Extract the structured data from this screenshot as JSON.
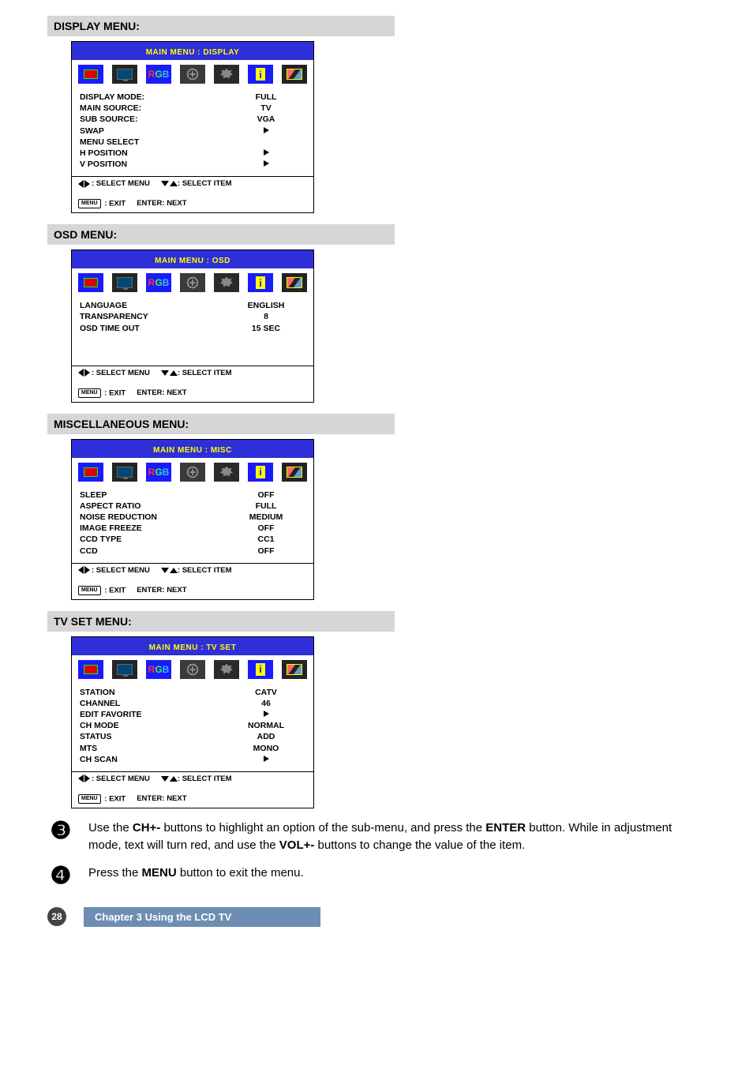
{
  "sections": {
    "display": {
      "header": "DISPLAY MENU:"
    },
    "osd": {
      "header": "OSD MENU:"
    },
    "misc": {
      "header": "MISCELLANEOUS MENU:"
    },
    "tvset": {
      "header": "TV SET MENU:"
    }
  },
  "panels": {
    "display": {
      "title": "MAIN MENU : DISPLAY",
      "rows": [
        {
          "label": "DISPLAY MODE:",
          "value": "FULL",
          "type": "text"
        },
        {
          "label": "MAIN SOURCE:",
          "value": "TV",
          "type": "text"
        },
        {
          "label": "SUB SOURCE:",
          "value": "VGA",
          "type": "text"
        },
        {
          "label": "SWAP",
          "type": "arrow"
        },
        {
          "label": "MENU SELECT",
          "type": "none"
        },
        {
          "label": "H POSITION",
          "type": "arrow"
        },
        {
          "label": "V POSITION",
          "type": "arrow"
        }
      ]
    },
    "osd": {
      "title": "MAIN MENU : OSD",
      "rows": [
        {
          "label": "LANGUAGE",
          "value": "ENGLISH",
          "type": "text"
        },
        {
          "label": "TRANSPARENCY",
          "value": "8",
          "type": "text"
        },
        {
          "label": "OSD TIME OUT",
          "value": "15 SEC",
          "type": "text"
        }
      ]
    },
    "misc": {
      "title": "MAIN MENU : MISC",
      "rows": [
        {
          "label": "SLEEP",
          "value": "OFF",
          "type": "text"
        },
        {
          "label": "ASPECT RATIO",
          "value": "FULL",
          "type": "text"
        },
        {
          "label": "NOISE REDUCTION",
          "value": "MEDIUM",
          "type": "text"
        },
        {
          "label": "IMAGE FREEZE",
          "value": "OFF",
          "type": "text"
        },
        {
          "label": "CCD TYPE",
          "value": "CC1",
          "type": "text"
        },
        {
          "label": "CCD",
          "value": "OFF",
          "type": "text"
        }
      ]
    },
    "tvset": {
      "title": "MAIN MENU : TV SET",
      "rows": [
        {
          "label": "STATION",
          "value": "CATV",
          "type": "text"
        },
        {
          "label": "CHANNEL",
          "value": "46",
          "type": "text"
        },
        {
          "label": "EDIT FAVORITE",
          "type": "arrow"
        },
        {
          "label": "CH MODE",
          "value": "NORMAL",
          "type": "text"
        },
        {
          "label": "STATUS",
          "value": "ADD",
          "type": "text"
        },
        {
          "label": "MTS",
          "value": "MONO",
          "type": "text"
        },
        {
          "label": "CH SCAN",
          "type": "arrow"
        }
      ]
    }
  },
  "footer_legend": {
    "select_menu": ": SELECT MENU",
    "select_item": ": SELECT ITEM",
    "exit_label": " : EXIT",
    "enter_next": "ENTER: NEXT",
    "menu_badge": "MENU"
  },
  "steps": {
    "three": {
      "num": "❸",
      "text_before": "Use the ",
      "bold1": "CH+-",
      "text_mid1": " buttons to highlight an option of the sub-menu, and press the ",
      "bold2": "ENTER",
      "text_mid2": " button. While in adjustment mode, text will turn red, and use the ",
      "bold3": "VOL+-",
      "text_after": " buttons to change the value of the item."
    },
    "four": {
      "num": "❹",
      "text_before": "Press the ",
      "bold1": "MENU",
      "text_after": " button to exit the menu."
    }
  },
  "page_footer": {
    "page_num": "28",
    "chapter": "Chapter 3 Using the LCD TV"
  },
  "icon_names": {
    "video": "video-icon",
    "display": "display-icon",
    "rgb": "rgb-icon",
    "osd": "osd-icon",
    "misc": "misc-icon",
    "info": "info-icon",
    "tv": "tv-icon"
  }
}
